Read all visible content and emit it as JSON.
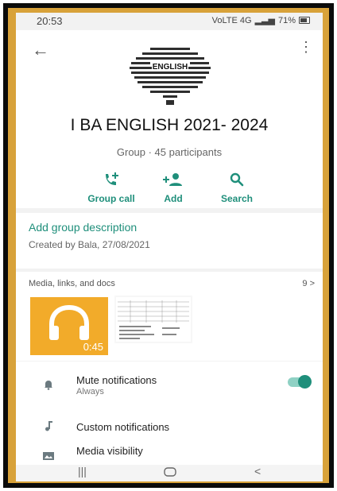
{
  "status": {
    "time": "20:53",
    "signal_text": "VoLTE 4G",
    "battery": "71%"
  },
  "header": {
    "title": "I BA ENGLISH 2021- 2024",
    "subtitle": "Group · 45 participants",
    "cloud_word": "ENGLISH"
  },
  "actions": [
    {
      "label": "Group call",
      "icon": "phone-add-icon"
    },
    {
      "label": "Add",
      "icon": "person-add-icon"
    },
    {
      "label": "Search",
      "icon": "search-icon"
    }
  ],
  "description": {
    "add_label": "Add group description",
    "created_by": "Created by Bala, 27/08/2021"
  },
  "media": {
    "header": "Media, links, and docs",
    "count": "9 >",
    "audio_duration": "0:45"
  },
  "settings": {
    "mute": {
      "label": "Mute notifications",
      "value": "Always"
    },
    "custom": {
      "label": "Custom notifications"
    },
    "visibility": {
      "label": "Media visibility"
    }
  },
  "colors": {
    "accent": "#1f8f7b",
    "audio_thumb": "#f2ab2a",
    "frame_gold": "#d8a23a"
  }
}
